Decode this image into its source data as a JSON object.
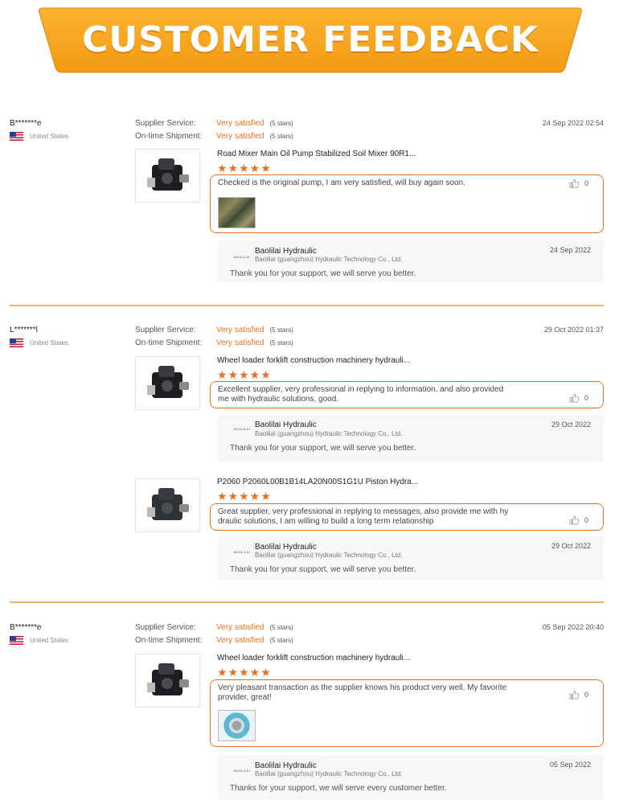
{
  "banner": {
    "title": "CUSTOMER FEEDBACK",
    "color": "#f7a21b"
  },
  "labels": {
    "supplier_service": "Supplier Service:",
    "ontime_shipment": "On-time Shipment:",
    "stars_suffix": "(5 stars)"
  },
  "reviews": [
    {
      "user": "B*******e",
      "country": "United States",
      "supplier_rating": "Very satisfied",
      "shipment_rating": "Very satisfied",
      "date": "24 Sep 2022 02:54",
      "items": [
        {
          "product": "Road Mixer Main Oil Pump Stabilized Soil Mixer 90R1...",
          "stars": "★★★★★",
          "comment": "Checked is the original pump, I am very satisfied, will buy again soon.",
          "likes": "0",
          "has_photo": true,
          "reply": {
            "logo": "BAOLILAI",
            "name": "Baolilai Hydraulic",
            "company": "Baolilai (guangzhou) Hydraulic Technology Co., Ltd.",
            "date": "24 Sep 2022",
            "text": "Thank you for your support, we will serve you better."
          }
        }
      ]
    },
    {
      "user": "L*******l",
      "country": "United States",
      "supplier_rating": "Very satisfied",
      "shipment_rating": "Very satisfied",
      "date": "29 Oct 2022 01:37",
      "items": [
        {
          "product": "Wheel loader forklift construction machinery hydrauli...",
          "stars": "★★★★★",
          "comment_line1": "Excellent supplier, very professional in replying to information, and also provided",
          "comment_line2": "me with hydraulic solutions, good.",
          "likes": "0",
          "reply": {
            "logo": "BAOLILAI",
            "name": "Baolilai Hydraulic",
            "company": "Baolilai (guangzhou) Hydraulic Technology Co., Ltd.",
            "date": "29 Oct 2022",
            "text": "Thank you for your support, we will serve you better."
          }
        },
        {
          "product": "P2060 P2060L00B1B14LA20N00S1G1U Piston Hydra...",
          "stars": "★★★★★",
          "comment_line1": "Great supplier, very professional in replying to messages, also provide me with hy",
          "comment_line2": "draulic solutions, I am willing to build a long term relationship",
          "likes": "0",
          "reply": {
            "logo": "BAOLILAI",
            "name": "Baolilai Hydraulic",
            "company": "Baolilai (guangzhou) Hydraulic Technology Co., Ltd.",
            "date": "29 Oct 2022",
            "text": "Thank you for your support, we will serve you better."
          }
        }
      ]
    },
    {
      "user": "B*******e",
      "country": "United States",
      "supplier_rating": "Very satisfied",
      "shipment_rating": "Very satisfied",
      "date": "05 Sep 2022 20:40",
      "items": [
        {
          "product": "Wheel loader forklift construction machinery hydrauli...",
          "stars": "★★★★★",
          "comment_line1": "Very pleasant transaction as the supplier knows his product very well. My favorite",
          "comment_line2": "provider, great!",
          "likes": "0",
          "has_photo": true,
          "reply": {
            "logo": "BAOLILAI",
            "name": "Baolilai Hydraulic",
            "company": "Baolilai (guangzhou) Hydraulic Technology Co., Ltd.",
            "date": "05 Sep 2022",
            "text": "Thanks for your support, we will serve every customer better."
          }
        }
      ]
    }
  ],
  "colors": {
    "accent": "#e8711f",
    "divider": "#f0b46a",
    "reply_bg": "#f7f7f9"
  }
}
